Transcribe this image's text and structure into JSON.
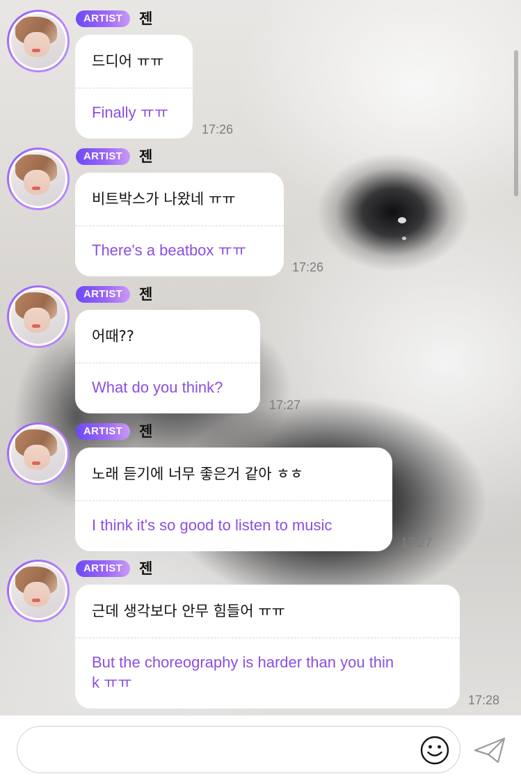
{
  "messages": [
    {
      "badge": "ARTIST",
      "sender": "젠",
      "korean": "드디어 ㅠㅠ",
      "english": "Finally ㅠㅠ",
      "time": "17:26"
    },
    {
      "badge": "ARTIST",
      "sender": "젠",
      "korean": "비트박스가 나왔네 ㅠㅠ",
      "english": "There's a beatbox ㅠㅠ",
      "time": "17:26"
    },
    {
      "badge": "ARTIST",
      "sender": "젠",
      "korean": "어때??",
      "english": "What do you think?",
      "time": "17:27"
    },
    {
      "badge": "ARTIST",
      "sender": "젠",
      "korean": "노래 듣기에 너무 좋은거 같아 ㅎㅎ",
      "english": "I think it's so good to listen to music",
      "time": "17:27"
    },
    {
      "badge": "ARTIST",
      "sender": "젠",
      "korean": "근데 생각보다 안무 힘들어 ㅠㅠ",
      "english_line1": "But the choreography is harder than you thin",
      "english_line2": "k ㅠㅠ",
      "time": "17:28"
    }
  ],
  "composer": {
    "placeholder": "",
    "emoji_icon": "smiley-face-icon",
    "send_icon": "paper-plane-icon"
  },
  "colors": {
    "badge_gradient_start": "#6d4af5",
    "badge_gradient_end": "#c89af7",
    "translation_text": "#8a4fe0",
    "timestamp": "#7d7d7d"
  }
}
